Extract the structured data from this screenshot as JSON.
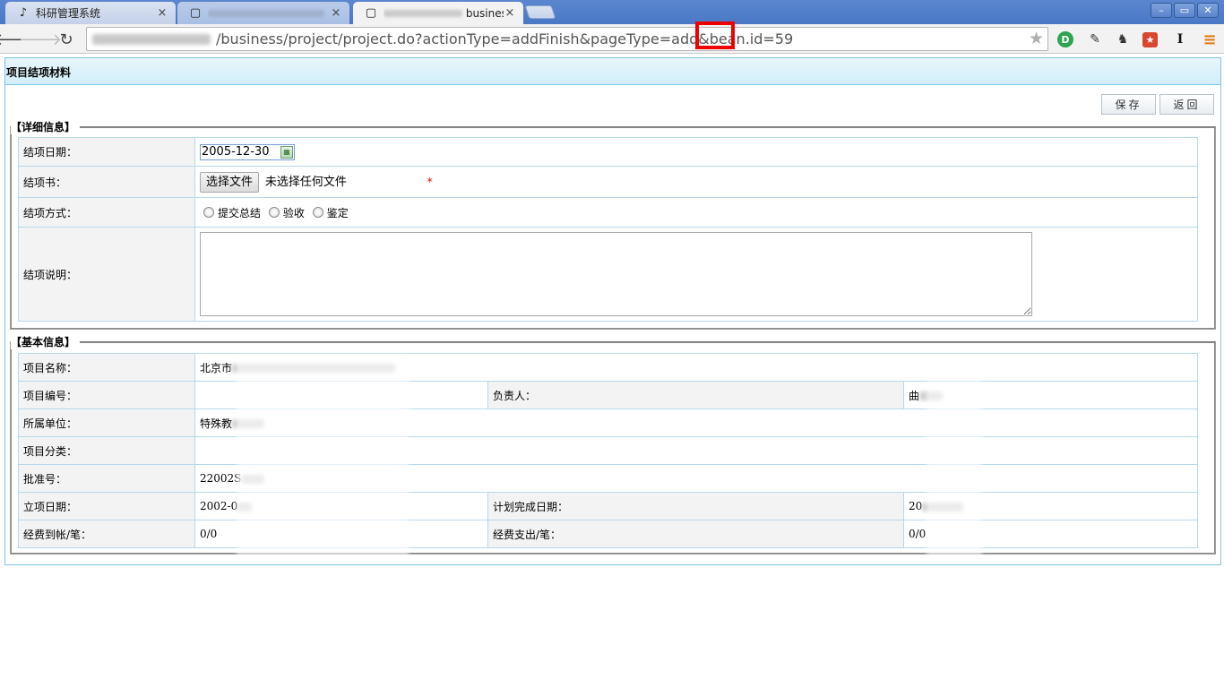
{
  "browser": {
    "tabs": [
      {
        "title": "科研管理系统",
        "close": "×"
      },
      {
        "title": "",
        "close": "×"
      },
      {
        "title": "busines",
        "close": "×"
      }
    ],
    "url_path": "/business/project/project.do?actionType=addFinish&pageType=add&bean.id=59",
    "window_buttons": {
      "minimize": "–",
      "restore": "▭",
      "close": "✕"
    }
  },
  "page": {
    "title": "项目结项材料",
    "buttons": {
      "save": "保存",
      "back": "返回"
    },
    "detail": {
      "legend": "【详细信息】",
      "finish_date_label": "结项日期：",
      "finish_date_value": "2005-12-30",
      "report_label": "结项书：",
      "choose_file": "选择文件",
      "no_file": "未选择任何文件",
      "required_mark": "*",
      "method_label": "结项方式：",
      "methods": [
        "提交总结",
        "验收",
        "鉴定"
      ],
      "description_label": "结项说明："
    },
    "basic": {
      "legend": "【基本信息】",
      "name_label": "项目名称：",
      "name_value": "北京市",
      "number_label": "项目编号：",
      "number_value": "",
      "leader_label": "负责人：",
      "leader_value": "曲",
      "unit_label": "所属单位：",
      "unit_value": "特殊教",
      "category_label": "项目分类：",
      "category_value": "",
      "approval_label": "批准号：",
      "approval_value": "22002S",
      "start_label": "立项日期：",
      "start_value": "2002-0",
      "plan_end_label": "计划完成日期：",
      "plan_end_value": "20",
      "funds_in_label": "经费到帐/笔：",
      "funds_in_value": "0/0",
      "funds_out_label": "经费支出/笔：",
      "funds_out_value": "0/0"
    }
  }
}
